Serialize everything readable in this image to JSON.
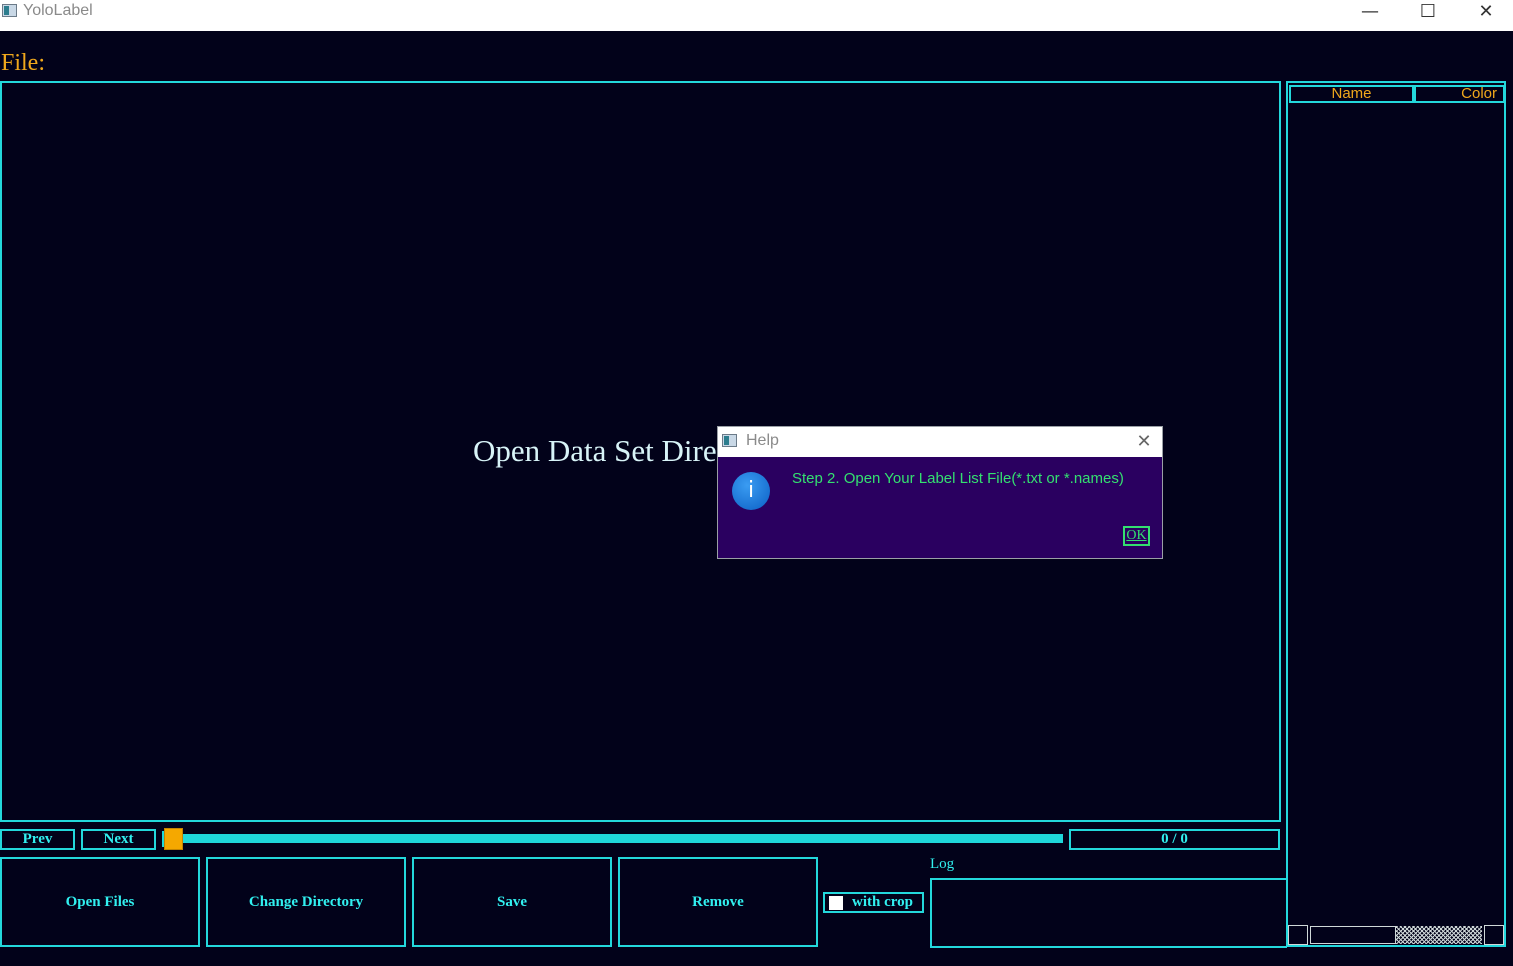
{
  "window": {
    "title": "YoloLabel",
    "minimize_glyph": "—",
    "maximize_glyph": "☐",
    "close_glyph": "✕"
  },
  "file": {
    "label": "File:"
  },
  "viewport": {
    "message": "Open Data Set Dire"
  },
  "label_table": {
    "columns": [
      "Name",
      "Color"
    ],
    "rows": []
  },
  "navigation": {
    "prev_label": "Prev",
    "next_label": "Next",
    "counter": "0 / 0",
    "slider_position": 0
  },
  "actions": {
    "open_files": "Open Files",
    "change_directory": "Change Directory",
    "save": "Save",
    "remove": "Remove"
  },
  "crop": {
    "label": "with crop",
    "checked": false
  },
  "log": {
    "title": "Log",
    "content": ""
  },
  "dialog": {
    "title": "Help",
    "close_glyph": "✕",
    "icon": "info-icon",
    "icon_glyph": "i",
    "message": "Step 2. Open Your Label List File(*.txt or *.names)",
    "ok_label": "OK"
  },
  "colors": {
    "background": "#02021a",
    "accent_cyan": "#23d8dc",
    "label_orange": "#f0a81c",
    "dialog_bg": "#2a0060",
    "dialog_text_green": "#34e070"
  }
}
